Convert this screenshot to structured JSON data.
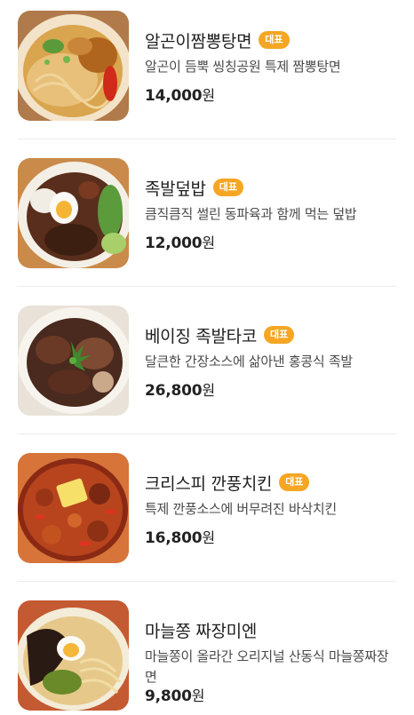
{
  "badge_label": "대표",
  "currency_label": "원",
  "colors": {
    "badge": "#f5a623",
    "text": "#222222",
    "description": "#4a4a4a",
    "divider": "#ececec"
  },
  "menu_items": [
    {
      "name": "알곤이짬뽕탕면",
      "badge": true,
      "description": "알곤이 듬뿍 씽칭공원 특제 짬뽕탕면",
      "price": "14,000"
    },
    {
      "name": "족발덮밥",
      "badge": true,
      "description": "큼직큼직 썰린 동파육과 함께 먹는 덮밥",
      "price": "12,000"
    },
    {
      "name": "베이징 족발타코",
      "badge": true,
      "description": "달큰한 간장소스에 삶아낸 홍콩식 족발",
      "price": "26,800"
    },
    {
      "name": "크리스피 깐풍치킨",
      "badge": true,
      "description": "특제 깐풍소스에 버무려진 바삭치킨",
      "price": "16,800"
    },
    {
      "name": "마늘쫑 짜장미엔",
      "badge": false,
      "description": "마늘쫑이 올라간 오리지널 산동식 마늘쫑짜장면",
      "price": "9,800"
    }
  ]
}
